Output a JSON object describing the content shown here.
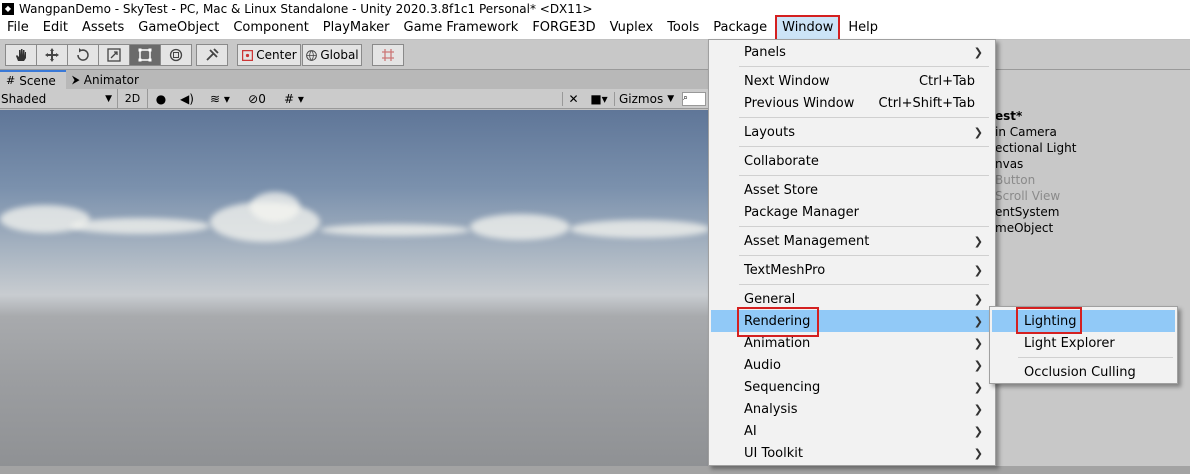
{
  "window": {
    "title": "WangpanDemo - SkyTest - PC, Mac & Linux Standalone - Unity 2020.3.8f1c1 Personal* <DX11>"
  },
  "menubar": {
    "items": [
      "File",
      "Edit",
      "Assets",
      "GameObject",
      "Component",
      "PlayMaker",
      "Game Framework",
      "FORGE3D",
      "Vuplex",
      "Tools",
      "Package",
      "Window",
      "Help"
    ],
    "active": "Window"
  },
  "toolbar": {
    "center_label": "Center",
    "global_label": "Global"
  },
  "scene_tabs": {
    "scene_label": "Scene",
    "animator_label": "Animator"
  },
  "scene_bar": {
    "shading_mode": "Shaded",
    "mode_2d": "2D",
    "hidden_count": "0",
    "gizmos_label": "Gizmos"
  },
  "hierarchy": {
    "items": [
      "est*",
      "in Camera",
      "ectional Light",
      "nvas",
      "Button",
      "Scroll View",
      "entSystem",
      "meObject"
    ]
  },
  "window_menu": {
    "items": [
      {
        "label": "Panels",
        "submenu": true
      },
      {
        "label": "Next Window",
        "shortcut": "Ctrl+Tab"
      },
      {
        "label": "Previous Window",
        "shortcut": "Ctrl+Shift+Tab"
      },
      {
        "label": "Layouts",
        "submenu": true
      },
      {
        "label": "Collaborate"
      },
      {
        "label": "Asset Store"
      },
      {
        "label": "Package Manager"
      },
      {
        "label": "Asset Management",
        "submenu": true
      },
      {
        "label": "TextMeshPro",
        "submenu": true
      },
      {
        "label": "General",
        "submenu": true
      },
      {
        "label": "Rendering",
        "submenu": true
      },
      {
        "label": "Animation",
        "submenu": true
      },
      {
        "label": "Audio",
        "submenu": true
      },
      {
        "label": "Sequencing",
        "submenu": true
      },
      {
        "label": "Analysis",
        "submenu": true
      },
      {
        "label": "AI",
        "submenu": true
      },
      {
        "label": "UI Toolkit",
        "submenu": true
      }
    ],
    "highlighted": "Rendering"
  },
  "rendering_submenu": {
    "items": [
      "Lighting",
      "Light Explorer",
      "Occlusion Culling"
    ],
    "highlighted": "Lighting"
  },
  "colors": {
    "highlight": "#91c9f7",
    "annotation_box": "#d42020"
  }
}
